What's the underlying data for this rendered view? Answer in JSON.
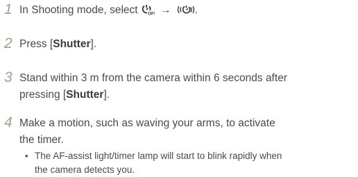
{
  "steps": [
    {
      "number": "1",
      "text_before": "In Shooting mode, select",
      "arrow": "→",
      "text_after": ".",
      "icons": [
        "self-timer-off-icon",
        "motion-timer-icon"
      ]
    },
    {
      "number": "2",
      "text_before": "Press [",
      "bold": "Shutter",
      "text_after": "]."
    },
    {
      "number": "3",
      "line1": "Stand within 3 m from the camera within 6 seconds after",
      "line2_before": "pressing [",
      "bold": "Shutter",
      "line2_after": "]."
    },
    {
      "number": "4",
      "line1": "Make a motion, such as waving your arms, to activate",
      "line2": "the timer.",
      "bullet": {
        "symbol": "•",
        "line1": "The AF-assist light/timer lamp will start to blink rapidly when",
        "line2": "the camera detects you."
      }
    }
  ]
}
